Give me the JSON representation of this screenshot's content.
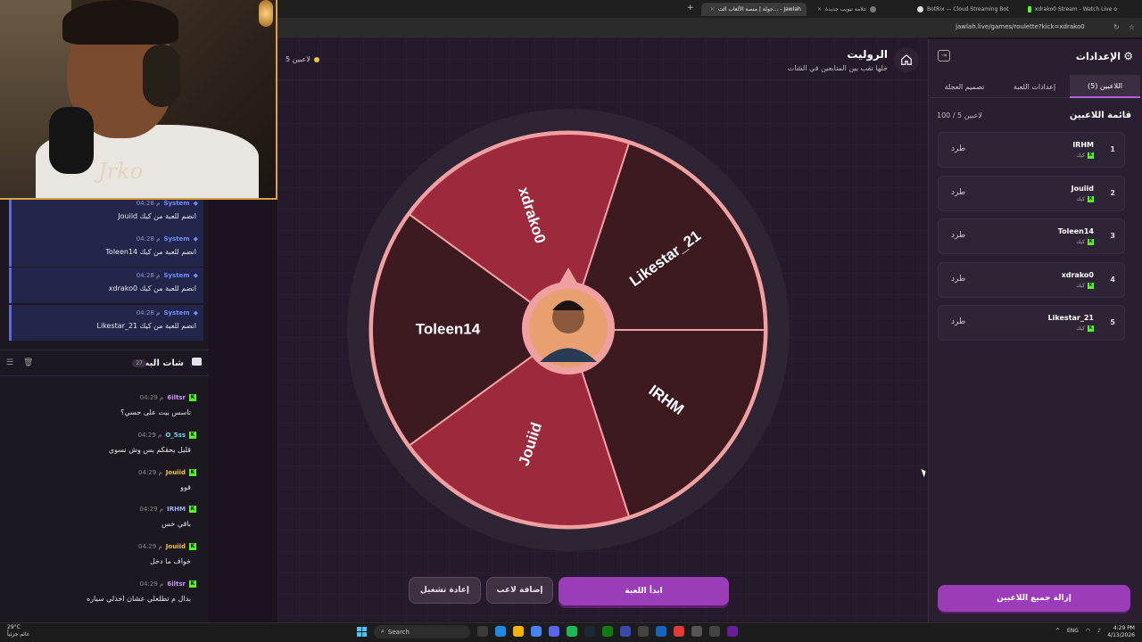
{
  "browser": {
    "tabs": [
      {
        "label": "جولة | منصة الألعاب الت... - Jawlah",
        "active": true
      },
      {
        "label": "علامة تبويب جديدة",
        "active": false
      },
      {
        "label": "BotRix — Cloud Streaming Bot",
        "active": false
      },
      {
        "label": "xdrako0 Stream - Watch Live o",
        "active": false
      }
    ],
    "new_tab_icon": "plus-icon",
    "url": "jawlah.live/games/roulette?kick=xdrako0"
  },
  "chat": {
    "system_messages": [
      {
        "user": "System",
        "time": "04:28 م",
        "text": "Jouiid انضم للعبة من كيك"
      },
      {
        "user": "System",
        "time": "04:28 م",
        "text": "Toleen14 انضم للعبة من كيك"
      },
      {
        "user": "System",
        "time": "04:28 م",
        "text": "xdrako0 انضم للعبة من كيك"
      },
      {
        "user": "System",
        "time": "04:28 م",
        "text": "Likestar_21 انضم للعبة من كيك"
      }
    ],
    "header_title": "شات البث",
    "header_count": "27",
    "messages": [
      {
        "user": "6iltsr",
        "time": "04:29 م",
        "text": "تاسس بيت على حسي؟",
        "color": "#c891ff"
      },
      {
        "user": "O_5ss",
        "time": "04:29 م",
        "text": "قليل يحقكم بس وش نسوي",
        "color": "#66d9ef"
      },
      {
        "user": "Jouiid",
        "time": "04:29 م",
        "text": "قوو",
        "color": "#f4c430"
      },
      {
        "user": "IRHM",
        "time": "04:29 م",
        "text": "باقي خس",
        "color": "#9fb4ff"
      },
      {
        "user": "Jouiid",
        "time": "04:29 م",
        "text": "خواف ما دخل",
        "color": "#f4c430"
      },
      {
        "user": "6iltsr",
        "time": "04:29 م",
        "text": "بدال م تطلعلي عشان اخذلي سياره",
        "color": "#c891ff"
      }
    ]
  },
  "game": {
    "title": "الروليت",
    "subtitle": "خلها تقب بين المتابعين في الشات",
    "player_count": "5 لاعبين",
    "wheel": {
      "segments": [
        {
          "label": "xdrako0",
          "color": "#9c2a3c"
        },
        {
          "label": "Likestar_21",
          "color": "#3d1a1f"
        },
        {
          "label": "IRHM",
          "color": "#3d1a1f"
        },
        {
          "label": "Jouiid",
          "color": "#9c2a3c"
        },
        {
          "label": "Toleen14",
          "color": "#3d1a1f"
        }
      ]
    },
    "buttons": {
      "start": "ابدأ اللعبة",
      "add_player": "إضافة لاعب",
      "restart": "إعادة تشغيل"
    }
  },
  "settings": {
    "title": "الإعدادات",
    "tabs": [
      "اللاعبين (5)",
      "إعدادات اللعبة",
      "تصميم العجلة"
    ],
    "list_title": "قائمة اللاعبين",
    "list_count": "100 / 5 لاعبين",
    "players": [
      {
        "num": "1",
        "name": "IRHM",
        "platform": "كيك",
        "kick": "طرد"
      },
      {
        "num": "2",
        "name": "Jouiid",
        "platform": "كيك",
        "kick": "طرد"
      },
      {
        "num": "3",
        "name": "Toleen14",
        "platform": "كيك",
        "kick": "طرد"
      },
      {
        "num": "4",
        "name": "xdrako0",
        "platform": "كيك",
        "kick": "طرد"
      },
      {
        "num": "5",
        "name": "Likestar_21",
        "platform": "كيك",
        "kick": "طرد"
      }
    ],
    "remove_all": "إزالة جميع اللاعبين"
  },
  "taskbar": {
    "weather_temp": "29°C",
    "weather_desc": "غائم جزئياً",
    "search_placeholder": "Search",
    "lang": "ENG",
    "time": "4:29 PM",
    "date": "4/13/2026"
  },
  "colors": {
    "accent": "#9b3db8",
    "kick_green": "#53fc18",
    "wheel_rim": "#f0a0a0"
  }
}
